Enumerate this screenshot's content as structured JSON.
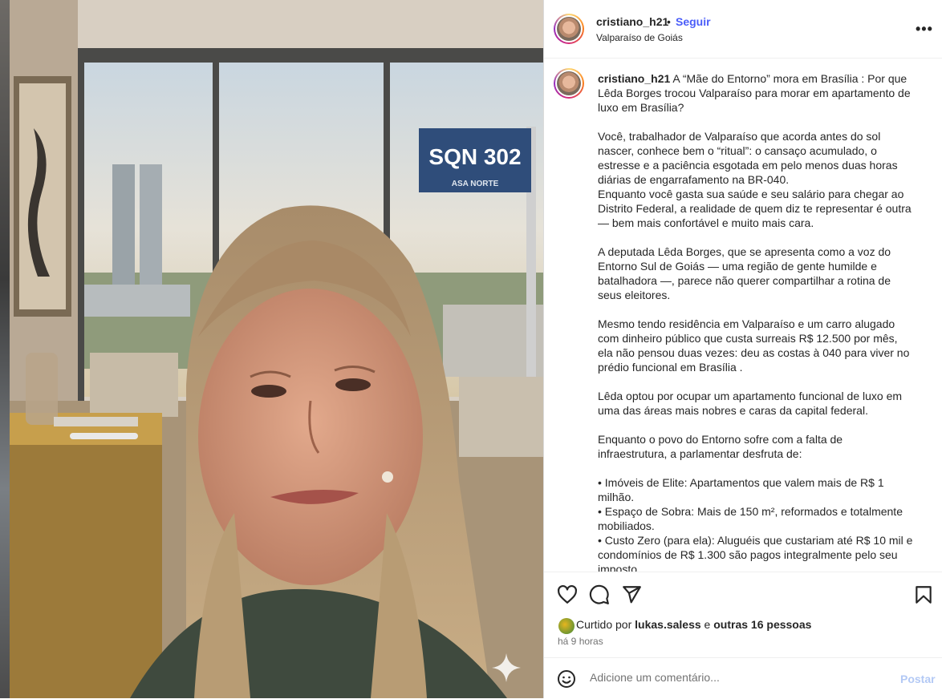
{
  "post": {
    "username": "cristiano_h21",
    "follow_label": "Seguir",
    "separator": "•",
    "location": "Valparaíso de Goiás",
    "more_label": "•••"
  },
  "caption": {
    "username": "cristiano_h21",
    "text": " A “Mãe do Entorno” mora em Brasília : Por que Lêda Borges trocou Valparaíso para morar em apartamento de luxo em Brasília?\n\nVocê, trabalhador de Valparaíso que acorda antes do sol nascer, conhece bem o “ritual”: o cansaço acumulado, o estresse e a paciência esgotada em pelo menos duas horas diárias de engarrafamento na BR-040.\nEnquanto você gasta sua saúde e seu salário para chegar ao Distrito Federal, a realidade de quem diz te representar é outra — bem mais confortável e muito mais cara.\n\nA deputada Lêda Borges, que se apresenta como a voz do Entorno Sul de Goiás — uma região de gente humilde e batalhadora —, parece não querer compartilhar a rotina de seus eleitores.\n\nMesmo tendo residência em Valparaíso e um carro alugado com dinheiro público que custa surreais R$ 12.500 por mês, ela não pensou duas vezes: deu as costas à 040 para viver no prédio funcional em Brasília .\n\nLêda optou por ocupar um apartamento funcional de luxo em uma das áreas mais nobres e caras da capital federal.\n\nEnquanto o povo do Entorno sofre com a falta de infraestrutura, a parlamentar desfruta de:\n\n• Imóveis de Elite: Apartamentos que valem mais de R$ 1 milhão.\n• Espaço de Sobra: Mais de 150 m², reformados e totalmente mobiliados.\n• Custo Zero (para ela): Aluguéis que custariam até R$ 10 mil e condomínios de R$ 1.300 são pagos integralmente pelo seu imposto.\n• Logística Privilegiada: Localizados nas quadras mais valorizadas"
  },
  "media": {
    "sign_text": "SQN 302",
    "sign_subtext": "ASA NORTE"
  },
  "actions": {
    "liked_by_prefix": "Curtido por ",
    "liked_by_user": "lukas.saless",
    "liked_by_mid": " e ",
    "liked_by_others": "outras 16 pessoas",
    "time_ago": "há 9 horas"
  },
  "comment": {
    "placeholder": "Adicione um comentário...",
    "post_label": "Postar"
  }
}
